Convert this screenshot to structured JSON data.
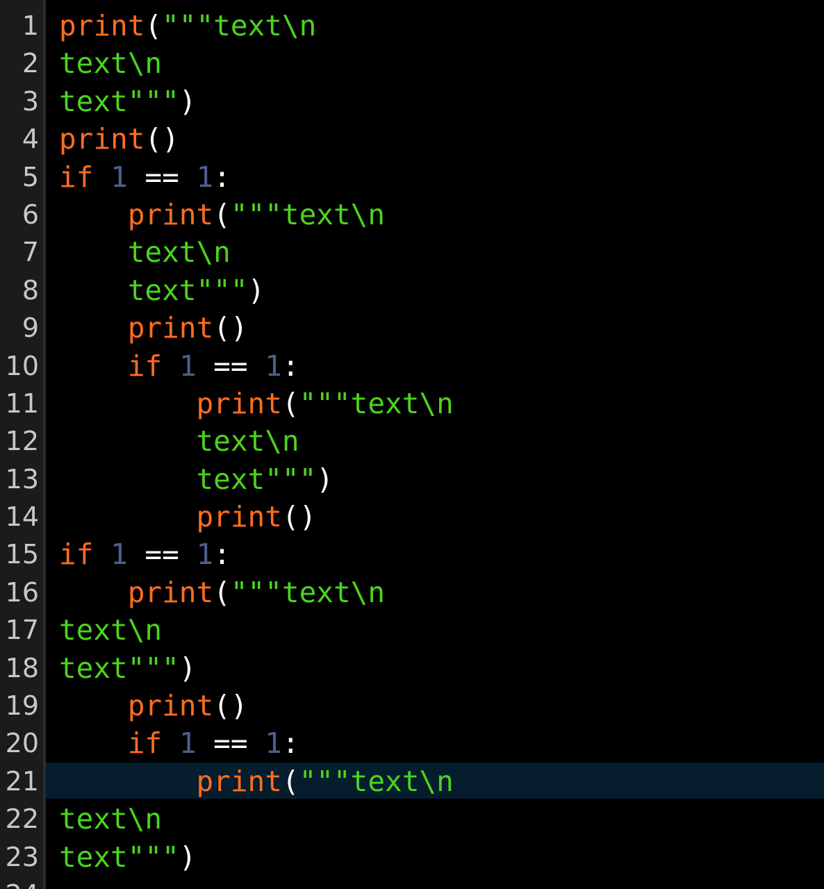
{
  "editor": {
    "current_line": 21,
    "colors": {
      "background": "#000000",
      "gutter": "#1b1b1b",
      "line_number": "#c8c8c8",
      "keyword": "#ff6d1f",
      "string": "#4bd41e",
      "number": "#4d5f8d",
      "default": "#ffffff",
      "current_line_highlight": "#051d2c"
    },
    "lines": [
      {
        "num": "1",
        "tokens": [
          {
            "t": "print",
            "c": "kw"
          },
          {
            "t": "(",
            "c": "df"
          },
          {
            "t": "\"\"\"text\\n",
            "c": "st"
          }
        ]
      },
      {
        "num": "2",
        "tokens": [
          {
            "t": "text\\n",
            "c": "st"
          }
        ]
      },
      {
        "num": "3",
        "tokens": [
          {
            "t": "text\"\"\"",
            "c": "st"
          },
          {
            "t": ")",
            "c": "df"
          }
        ]
      },
      {
        "num": "4",
        "tokens": [
          {
            "t": "print",
            "c": "kw"
          },
          {
            "t": "()",
            "c": "df"
          }
        ]
      },
      {
        "num": "5",
        "tokens": [
          {
            "t": "if",
            "c": "kw"
          },
          {
            "t": " ",
            "c": "df"
          },
          {
            "t": "1",
            "c": "nm"
          },
          {
            "t": " == ",
            "c": "df"
          },
          {
            "t": "1",
            "c": "nm"
          },
          {
            "t": ":",
            "c": "df"
          }
        ]
      },
      {
        "num": "6",
        "tokens": [
          {
            "t": "    ",
            "c": "df"
          },
          {
            "t": "print",
            "c": "kw"
          },
          {
            "t": "(",
            "c": "df"
          },
          {
            "t": "\"\"\"text\\n",
            "c": "st"
          }
        ]
      },
      {
        "num": "7",
        "tokens": [
          {
            "t": "    ",
            "c": "df"
          },
          {
            "t": "text\\n",
            "c": "st"
          }
        ]
      },
      {
        "num": "8",
        "tokens": [
          {
            "t": "    ",
            "c": "df"
          },
          {
            "t": "text\"\"\"",
            "c": "st"
          },
          {
            "t": ")",
            "c": "df"
          }
        ]
      },
      {
        "num": "9",
        "tokens": [
          {
            "t": "    ",
            "c": "df"
          },
          {
            "t": "print",
            "c": "kw"
          },
          {
            "t": "()",
            "c": "df"
          }
        ]
      },
      {
        "num": "10",
        "tokens": [
          {
            "t": "    ",
            "c": "df"
          },
          {
            "t": "if",
            "c": "kw"
          },
          {
            "t": " ",
            "c": "df"
          },
          {
            "t": "1",
            "c": "nm"
          },
          {
            "t": " == ",
            "c": "df"
          },
          {
            "t": "1",
            "c": "nm"
          },
          {
            "t": ":",
            "c": "df"
          }
        ]
      },
      {
        "num": "11",
        "tokens": [
          {
            "t": "        ",
            "c": "df"
          },
          {
            "t": "print",
            "c": "kw"
          },
          {
            "t": "(",
            "c": "df"
          },
          {
            "t": "\"\"\"text\\n",
            "c": "st"
          }
        ]
      },
      {
        "num": "12",
        "tokens": [
          {
            "t": "        ",
            "c": "df"
          },
          {
            "t": "text\\n",
            "c": "st"
          }
        ]
      },
      {
        "num": "13",
        "tokens": [
          {
            "t": "        ",
            "c": "df"
          },
          {
            "t": "text\"\"\"",
            "c": "st"
          },
          {
            "t": ")",
            "c": "df"
          }
        ]
      },
      {
        "num": "14",
        "tokens": [
          {
            "t": "        ",
            "c": "df"
          },
          {
            "t": "print",
            "c": "kw"
          },
          {
            "t": "()",
            "c": "df"
          }
        ]
      },
      {
        "num": "15",
        "tokens": [
          {
            "t": "if",
            "c": "kw"
          },
          {
            "t": " ",
            "c": "df"
          },
          {
            "t": "1",
            "c": "nm"
          },
          {
            "t": " == ",
            "c": "df"
          },
          {
            "t": "1",
            "c": "nm"
          },
          {
            "t": ":",
            "c": "df"
          }
        ]
      },
      {
        "num": "16",
        "tokens": [
          {
            "t": "    ",
            "c": "df"
          },
          {
            "t": "print",
            "c": "kw"
          },
          {
            "t": "(",
            "c": "df"
          },
          {
            "t": "\"\"\"text\\n",
            "c": "st"
          }
        ]
      },
      {
        "num": "17",
        "tokens": [
          {
            "t": "text\\n",
            "c": "st"
          }
        ]
      },
      {
        "num": "18",
        "tokens": [
          {
            "t": "text\"\"\"",
            "c": "st"
          },
          {
            "t": ")",
            "c": "df"
          }
        ]
      },
      {
        "num": "19",
        "tokens": [
          {
            "t": "    ",
            "c": "df"
          },
          {
            "t": "print",
            "c": "kw"
          },
          {
            "t": "()",
            "c": "df"
          }
        ]
      },
      {
        "num": "20",
        "tokens": [
          {
            "t": "    ",
            "c": "df"
          },
          {
            "t": "if",
            "c": "kw"
          },
          {
            "t": " ",
            "c": "df"
          },
          {
            "t": "1",
            "c": "nm"
          },
          {
            "t": " == ",
            "c": "df"
          },
          {
            "t": "1",
            "c": "nm"
          },
          {
            "t": ":",
            "c": "df"
          }
        ]
      },
      {
        "num": "21",
        "tokens": [
          {
            "t": "        ",
            "c": "df"
          },
          {
            "t": "print",
            "c": "kw"
          },
          {
            "t": "(",
            "c": "df"
          },
          {
            "t": "\"\"\"text\\n",
            "c": "st"
          }
        ]
      },
      {
        "num": "22",
        "tokens": [
          {
            "t": "text\\n",
            "c": "st"
          }
        ]
      },
      {
        "num": "23",
        "tokens": [
          {
            "t": "text\"\"\"",
            "c": "st"
          },
          {
            "t": ")",
            "c": "df"
          }
        ]
      },
      {
        "num": "24",
        "tokens": []
      }
    ]
  }
}
